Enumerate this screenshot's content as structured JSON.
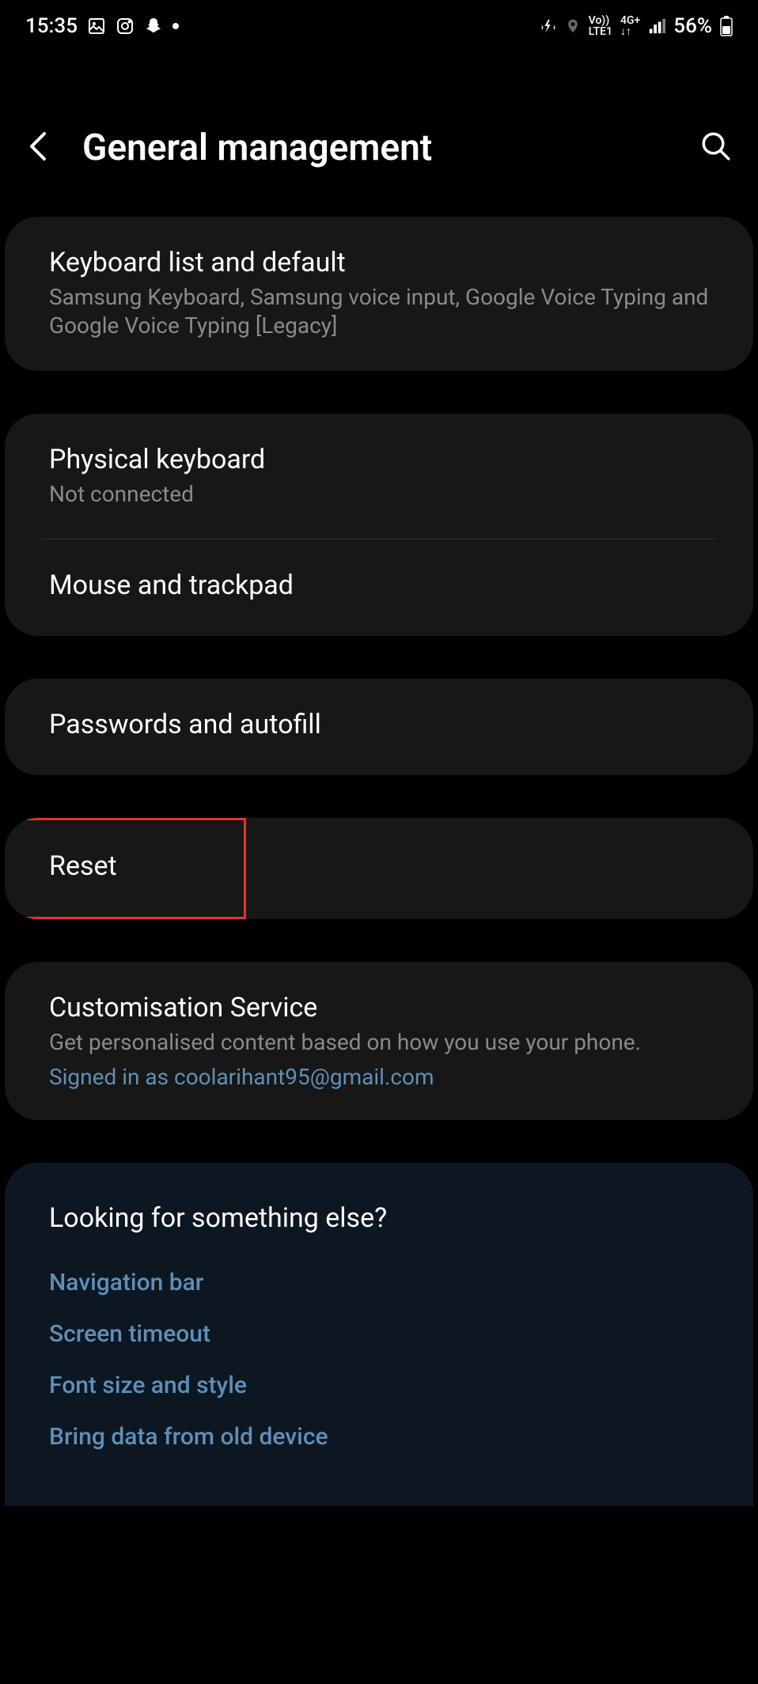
{
  "statusBar": {
    "time": "15:35",
    "battery": "56%"
  },
  "header": {
    "title": "General management"
  },
  "settings": {
    "keyboardList": {
      "title": "Keyboard list and default",
      "subtitle": "Samsung Keyboard, Samsung voice input, Google Voice Typing and Google Voice Typing [Legacy]"
    },
    "physicalKeyboard": {
      "title": "Physical keyboard",
      "subtitle": "Not connected"
    },
    "mouseTrackpad": {
      "title": "Mouse and trackpad"
    },
    "passwordsAutofill": {
      "title": "Passwords and autofill"
    },
    "reset": {
      "title": "Reset"
    },
    "customisation": {
      "title": "Customisation Service",
      "subtitle": "Get personalised content based on how you use your phone.",
      "signedIn": "Signed in as coolarihant95@gmail.com"
    }
  },
  "suggestions": {
    "heading": "Looking for something else?",
    "links": {
      "navBar": "Navigation bar",
      "screenTimeout": "Screen timeout",
      "fontSize": "Font size and style",
      "bringData": "Bring data from old device"
    }
  }
}
